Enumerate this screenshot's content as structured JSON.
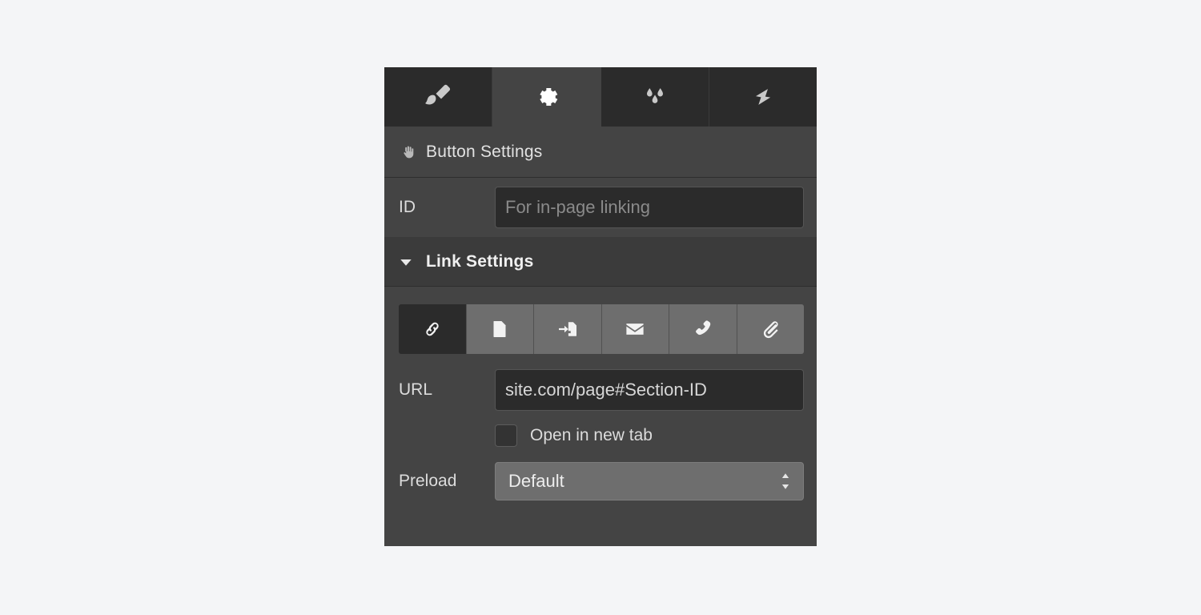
{
  "colors": {
    "page_background": "#f4f5f7",
    "panel_background": "#444444",
    "tabbar_background": "#2b2b2b",
    "active_tab_background": "#444444",
    "input_background": "#2b2b2b",
    "button_background": "#6e6e6e",
    "selected_button_background": "#2b2b2b",
    "text_primary": "#e2e2e2",
    "text_placeholder": "#8a8a8a"
  },
  "panel": {
    "tabs": [
      {
        "name": "style-tab",
        "icon": "paintbrush-icon",
        "active": false
      },
      {
        "name": "settings-tab",
        "icon": "gear-icon",
        "active": true
      },
      {
        "name": "effects-tab",
        "icon": "water-drops-icon",
        "active": false
      },
      {
        "name": "interactions-tab",
        "icon": "lightning-bolt-icon",
        "active": false
      }
    ],
    "button_settings": {
      "icon": "hand-icon",
      "title": "Button Settings",
      "id_field": {
        "label": "ID",
        "value": "",
        "placeholder": "For in-page linking"
      }
    },
    "link_settings": {
      "caret": "caret-down-icon",
      "title": "Link Settings",
      "expanded": true,
      "link_types": [
        {
          "name": "link-type-url",
          "icon": "chain-link-icon",
          "selected": true
        },
        {
          "name": "link-type-page",
          "icon": "page-icon",
          "selected": false
        },
        {
          "name": "link-type-section",
          "icon": "section-arrow-icon",
          "selected": false
        },
        {
          "name": "link-type-email",
          "icon": "envelope-icon",
          "selected": false
        },
        {
          "name": "link-type-phone",
          "icon": "phone-icon",
          "selected": false
        },
        {
          "name": "link-type-attachment",
          "icon": "paperclip-icon",
          "selected": false
        }
      ],
      "url_field": {
        "label": "URL",
        "value": "site.com/page#Section-ID",
        "placeholder": ""
      },
      "new_tab": {
        "label": "Open in new tab",
        "checked": false
      },
      "preload": {
        "label": "Preload",
        "value": "Default",
        "arrows": "stepper-arrows-icon"
      }
    }
  }
}
